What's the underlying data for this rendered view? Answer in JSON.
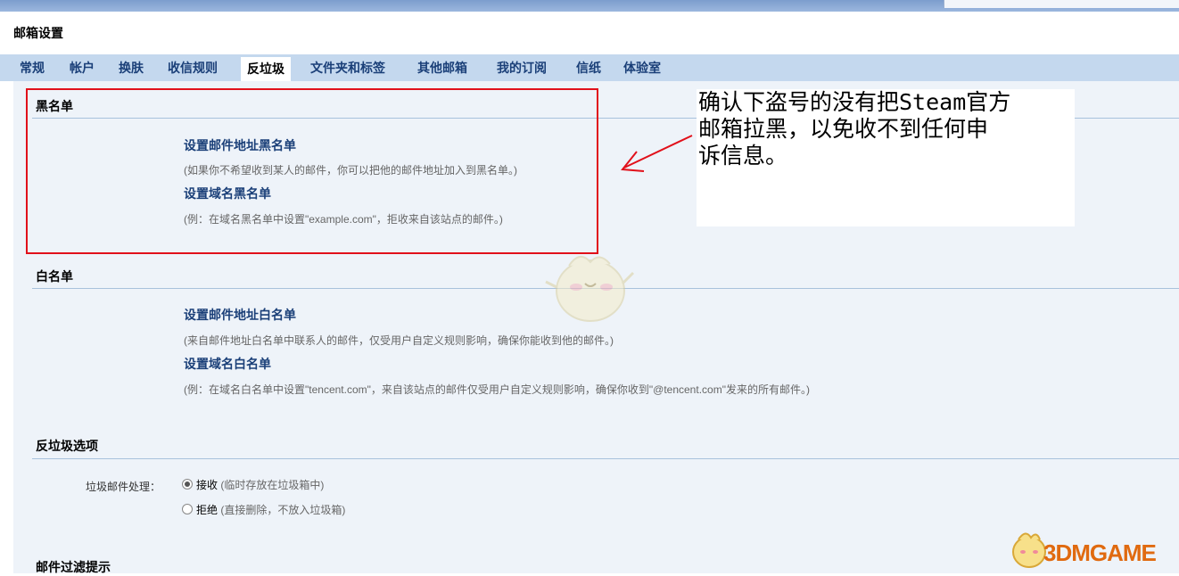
{
  "page_title": "邮箱设置",
  "tabs": [
    {
      "label": "常规"
    },
    {
      "label": "帐户"
    },
    {
      "label": "换肤"
    },
    {
      "label": "收信规则"
    },
    {
      "label": "反垃圾"
    },
    {
      "label": "文件夹和标签"
    },
    {
      "label": "其他邮箱"
    },
    {
      "label": "我的订阅"
    },
    {
      "label": "信纸"
    },
    {
      "label": "体验室"
    }
  ],
  "active_tab": "反垃圾",
  "blacklist": {
    "title": "黑名单",
    "address_link": "设置邮件地址黑名单",
    "address_desc": "(如果你不希望收到某人的邮件，你可以把他的邮件地址加入到黑名单。)",
    "domain_link": "设置域名黑名单",
    "domain_desc": "(例：在域名黑名单中设置\"example.com\"，拒收来自该站点的邮件。)"
  },
  "whitelist": {
    "title": "白名单",
    "address_link": "设置邮件地址白名单",
    "address_desc": "(来自邮件地址白名单中联系人的邮件，仅受用户自定义规则影响，确保你能收到他的邮件。)",
    "domain_link": "设置域名白名单",
    "domain_desc": "(例：在域名白名单中设置\"tencent.com\"，来自该站点的邮件仅受用户自定义规则影响，确保你收到\"@tencent.com\"发来的所有邮件。)"
  },
  "spam_options": {
    "title": "反垃圾选项",
    "label": "垃圾邮件处理：",
    "options": [
      {
        "label": "接收",
        "hint": "(临时存放在垃圾箱中)",
        "checked": true
      },
      {
        "label": "拒绝",
        "hint": "(直接删除，不放入垃圾箱)",
        "checked": false
      }
    ]
  },
  "filter_tip": {
    "title": "邮件过滤提示"
  },
  "annotation": {
    "lines": [
      "确认下盗号的没有把Steam官方",
      "邮箱拉黑，以免收不到任何申",
      "诉信息。"
    ],
    "color": "#e1101a"
  },
  "watermark": {
    "text": "3DMGAME"
  }
}
